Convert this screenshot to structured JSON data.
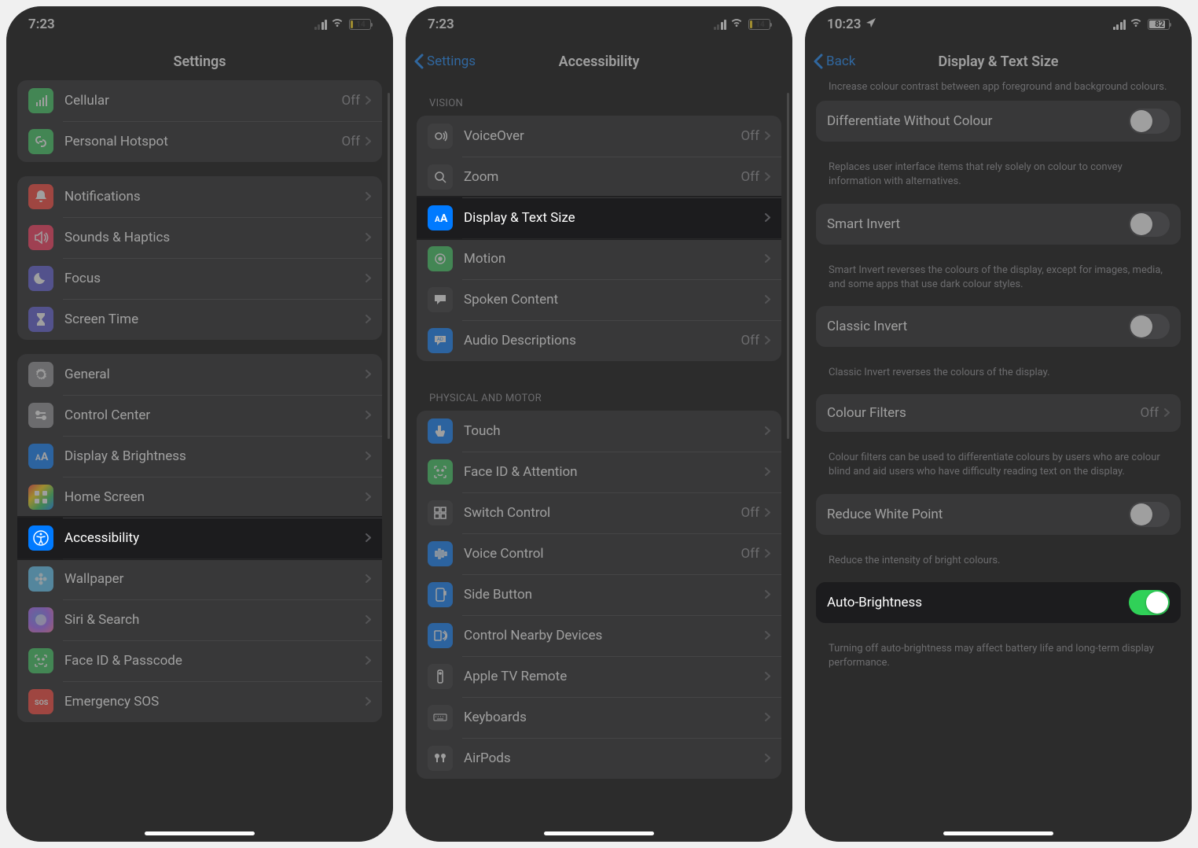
{
  "panel1": {
    "status": {
      "time": "7:23",
      "battery": "14",
      "battery_level": "low"
    },
    "title": "Settings",
    "groups": [
      {
        "rows": [
          {
            "icon": "antenna",
            "bg": "bg-green",
            "label": "Cellular",
            "value": "Off"
          },
          {
            "icon": "link",
            "bg": "bg-green",
            "label": "Personal Hotspot",
            "value": "Off"
          }
        ]
      },
      {
        "rows": [
          {
            "icon": "bell",
            "bg": "bg-red",
            "label": "Notifications"
          },
          {
            "icon": "speaker",
            "bg": "bg-pink",
            "label": "Sounds & Haptics"
          },
          {
            "icon": "moon",
            "bg": "bg-indigo",
            "label": "Focus"
          },
          {
            "icon": "hourglass",
            "bg": "bg-indigo",
            "label": "Screen Time"
          }
        ]
      },
      {
        "rows": [
          {
            "icon": "gear",
            "bg": "bg-gray",
            "label": "General"
          },
          {
            "icon": "switches",
            "bg": "bg-gray",
            "label": "Control Center"
          },
          {
            "icon": "textsize",
            "bg": "bg-blue",
            "label": "Display & Brightness"
          },
          {
            "icon": "grid",
            "bg": "bg-multicolor",
            "label": "Home Screen"
          },
          {
            "icon": "accessibility",
            "bg": "bg-blue",
            "label": "Accessibility",
            "hl": true
          },
          {
            "icon": "flower",
            "bg": "bg-teal",
            "label": "Wallpaper"
          },
          {
            "icon": "siri",
            "bg": "gradient-siri",
            "label": "Siri & Search"
          },
          {
            "icon": "faceid",
            "bg": "bg-green",
            "label": "Face ID & Passcode"
          },
          {
            "icon": "sos",
            "bg": "bg-red",
            "label": "Emergency SOS"
          }
        ]
      }
    ]
  },
  "panel2": {
    "status": {
      "time": "7:23",
      "battery": "14",
      "battery_level": "low"
    },
    "back": "Settings",
    "title": "Accessibility",
    "sections": [
      {
        "header": "VISION",
        "rows": [
          {
            "icon": "voiceover",
            "bg": "bg-dark",
            "label": "VoiceOver",
            "value": "Off"
          },
          {
            "icon": "zoom",
            "bg": "bg-dark",
            "label": "Zoom",
            "value": "Off"
          },
          {
            "icon": "textsize",
            "bg": "bg-blue",
            "label": "Display & Text Size",
            "hl": true
          },
          {
            "icon": "motion",
            "bg": "bg-green",
            "label": "Motion"
          },
          {
            "icon": "speech",
            "bg": "bg-dark",
            "label": "Spoken Content"
          },
          {
            "icon": "ad",
            "bg": "bg-blue",
            "label": "Audio Descriptions",
            "value": "Off"
          }
        ]
      },
      {
        "header": "PHYSICAL AND MOTOR",
        "rows": [
          {
            "icon": "touch",
            "bg": "bg-blue",
            "label": "Touch"
          },
          {
            "icon": "faceid",
            "bg": "bg-green",
            "label": "Face ID & Attention"
          },
          {
            "icon": "switch",
            "bg": "bg-dark",
            "label": "Switch Control",
            "value": "Off"
          },
          {
            "icon": "voice",
            "bg": "bg-blue",
            "label": "Voice Control",
            "value": "Off"
          },
          {
            "icon": "sidebutton",
            "bg": "bg-blue",
            "label": "Side Button"
          },
          {
            "icon": "nearby",
            "bg": "bg-blue",
            "label": "Control Nearby Devices"
          },
          {
            "icon": "tvremote",
            "bg": "bg-dark",
            "label": "Apple TV Remote"
          },
          {
            "icon": "keyboard",
            "bg": "bg-dark",
            "label": "Keyboards"
          },
          {
            "icon": "airpods",
            "bg": "bg-dark",
            "label": "AirPods"
          }
        ]
      }
    ]
  },
  "panel3": {
    "status": {
      "time": "10:23",
      "battery": "82",
      "battery_level": "high",
      "location": true
    },
    "back": "Back",
    "title": "Display & Text Size",
    "top_footer": "Increase colour contrast between app foreground and background colours.",
    "items": [
      {
        "type": "toggle",
        "label": "Differentiate Without Colour",
        "on": false,
        "footer": "Replaces user interface items that rely solely on colour to convey information with alternatives."
      },
      {
        "type": "toggle",
        "label": "Smart Invert",
        "on": false,
        "footer": "Smart Invert reverses the colours of the display, except for images, media, and some apps that use dark colour styles."
      },
      {
        "type": "toggle",
        "label": "Classic Invert",
        "on": false,
        "footer": "Classic Invert reverses the colours of the display."
      },
      {
        "type": "link",
        "label": "Colour Filters",
        "value": "Off",
        "footer": "Colour filters can be used to differentiate colours by users who are colour blind and aid users who have difficulty reading text on the display."
      },
      {
        "type": "toggle",
        "label": "Reduce White Point",
        "on": false,
        "footer": "Reduce the intensity of bright colours."
      },
      {
        "type": "toggle",
        "label": "Auto-Brightness",
        "on": true,
        "hl": true,
        "footer": "Turning off auto-brightness may affect battery life and long-term display performance."
      }
    ]
  }
}
